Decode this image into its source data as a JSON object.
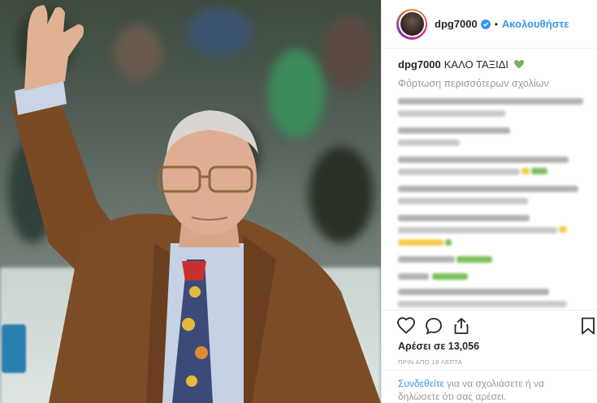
{
  "post": {
    "username": "dpg7000",
    "follow_label": "Ακολουθήστε",
    "separator": "•",
    "caption_user": "dpg7000",
    "caption_text": "ΚΑΛΟ ΤΑΞΙΔΙ",
    "caption_emoji": "green-heart-icon",
    "load_more": "Φόρτωση περισσότερων σχολίων",
    "likes_label": "Αρέσει σε 13,056",
    "time_ago": "ΠΡΙΝ ΑΠΟ 18 ΛΕΠΤΑ",
    "footer_login": "Συνδεθείτε",
    "footer_rest": " για να σχολιάσετε ή να δηλώσετε ότι σας αρέσει."
  },
  "icons": [
    "verified-icon",
    "heart-icon",
    "comment-icon",
    "share-icon",
    "bookmark-icon",
    "green-heart-icon"
  ],
  "colors": {
    "link_blue": "#3897f0",
    "text": "#262626",
    "muted": "#999999",
    "border": "#efefef",
    "emoji_green": "#78b159"
  },
  "comments_blurred": true
}
